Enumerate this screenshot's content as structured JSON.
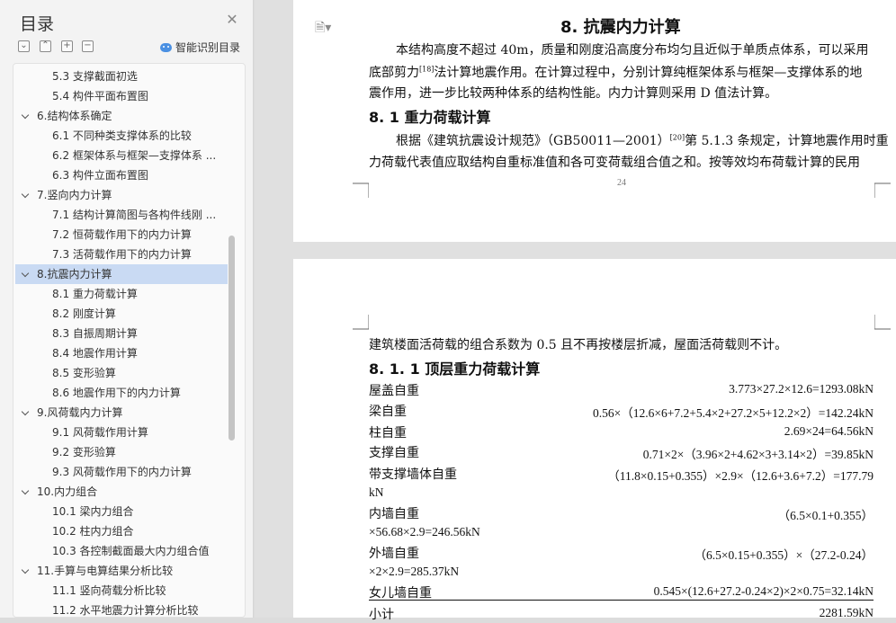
{
  "toc": {
    "title": "目录",
    "ai_label": "智能识别目录",
    "items": [
      {
        "label": "5.3 支撑截面初选",
        "level": 2
      },
      {
        "label": "5.4 构件平面布置图",
        "level": 2
      },
      {
        "label": "6.结构体系确定",
        "level": 1
      },
      {
        "label": "6.1 不同种类支撑体系的比较",
        "level": 2
      },
      {
        "label": "6.2 框架体系与框架—支撑体系 ...",
        "level": 2
      },
      {
        "label": "6.3 构件立面布置图",
        "level": 2
      },
      {
        "label": "7.竖向内力计算",
        "level": 1
      },
      {
        "label": "7.1 结构计算简图与各构件线刚 ...",
        "level": 2
      },
      {
        "label": "7.2 恒荷载作用下的内力计算",
        "level": 2
      },
      {
        "label": "7.3 活荷载作用下的内力计算",
        "level": 2
      },
      {
        "label": "8.抗震内力计算",
        "level": 1
      },
      {
        "label": "8.1 重力荷载计算",
        "level": 2
      },
      {
        "label": "8.2 刚度计算",
        "level": 2
      },
      {
        "label": "8.3 自振周期计算",
        "level": 2
      },
      {
        "label": "8.4 地震作用计算",
        "level": 2
      },
      {
        "label": "8.5 变形验算",
        "level": 2
      },
      {
        "label": "8.6 地震作用下的内力计算",
        "level": 2
      },
      {
        "label": "9.风荷载内力计算",
        "level": 1
      },
      {
        "label": "9.1 风荷载作用计算",
        "level": 2
      },
      {
        "label": "9.2 变形验算",
        "level": 2
      },
      {
        "label": "9.3 风荷载作用下的内力计算",
        "level": 2
      },
      {
        "label": "10.内力组合",
        "level": 1
      },
      {
        "label": "10.1 梁内力组合",
        "level": 2
      },
      {
        "label": "10.2 柱内力组合",
        "level": 2
      },
      {
        "label": "10.3 各控制截面最大内力组合值",
        "level": 2
      },
      {
        "label": "11.手算与电算结果分析比较",
        "level": 1
      },
      {
        "label": "11.1 竖向荷载分析比较",
        "level": 2
      },
      {
        "label": "11.2 水平地震力计算分析比较",
        "level": 2
      }
    ],
    "selected_label": "8.抗震内力计算"
  },
  "page1": {
    "heading": "8. 抗震内力计算",
    "para1_line1": "本结构高度不超过 40m，质量和刚度沿高度分布均匀且近似于单质点体系，可以采用",
    "para1_line2a": "底部剪力",
    "para1_ref": "[18]",
    "para1_line2b": "法计算地震作用。在计算过程中，分别计算纯框架体系与框架—支撑体系的地",
    "para1_line3": "震作用，进一步比较两种体系的结构性能。内力计算则采用 D 值法计算。",
    "sub_heading": "8. 1  重力荷载计算",
    "para2_line1a": "根据《建筑抗震设计规范》（GB50011—2001）",
    "para2_ref": "[20]",
    "para2_line1b": "第 5.1.3 条规定，计算地震作用时重",
    "para2_line2": "力荷载代表值应取结构自重标准值和各可变荷载组合值之和。按等效均布荷载计算的民用",
    "page_number": "24"
  },
  "page2": {
    "line1": "建筑楼面活荷载的组合系数为 0.5 且不再按楼层折减，屋面活荷载则不计。",
    "sub_heading": "8. 1. 1  顶层重力荷载计算",
    "rows": [
      {
        "label": "屋盖自重",
        "value": "3.773×27.2×12.6=1293.08kN",
        "cont": ""
      },
      {
        "label": "梁自重",
        "value": "0.56×（12.6×6+7.2+5.4×2+27.2×5+12.2×2）=142.24kN",
        "cont": ""
      },
      {
        "label": "柱自重",
        "value": "2.69×24=64.56kN",
        "cont": ""
      },
      {
        "label": "支撑自重",
        "value": "0.71×2×（3.96×2+4.62×3+3.14×2）=39.85kN",
        "cont": ""
      },
      {
        "label": "带支撑墙体自重",
        "value": "（11.8×0.15+0.355）×2.9×（12.6+3.6+7.2）=177.79",
        "cont": "kN"
      },
      {
        "label": "内墙自重",
        "value": "（6.5×0.1+0.355）",
        "cont": "×56.68×2.9=246.56kN"
      },
      {
        "label": "外墙自重",
        "value": "（6.5×0.15+0.355）×（27.2-0.24）",
        "cont": "×2×2.9=285.37kN"
      },
      {
        "label": "女儿墙自重",
        "value": "0.545×(12.6+27.2-0.24×2)×2×0.75=32.14kN",
        "cont": ""
      },
      {
        "label": "小计",
        "value": "2281.59kN",
        "cont": ""
      }
    ]
  },
  "colors": {
    "selected": "#c9daf3",
    "panel": "#f3f3f3",
    "doc_bg": "#e0e0e0"
  },
  "icons": [
    "close-icon",
    "collapse-all-icon",
    "expand-all-icon",
    "add-icon",
    "remove-icon",
    "ai-icon",
    "page-icon"
  ]
}
